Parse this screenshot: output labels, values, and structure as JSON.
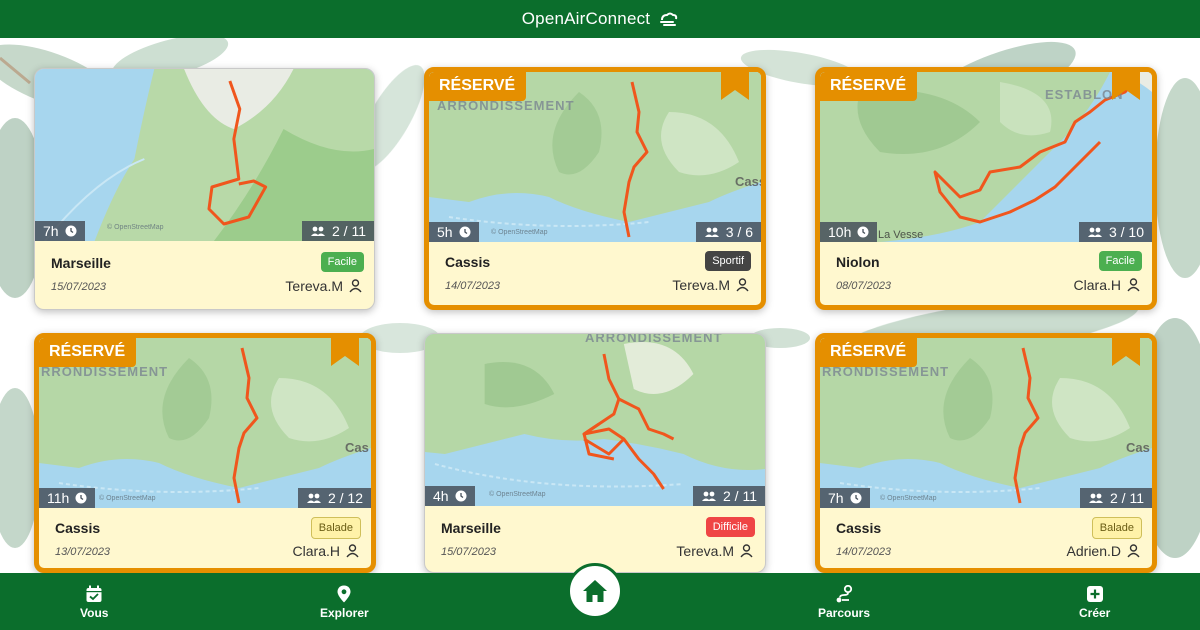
{
  "app": {
    "title": "OpenAirConnect",
    "logo_icon": "cloud-wind-icon",
    "brand_color": "#0b6e2c",
    "accent_color": "#e58f00"
  },
  "cards": [
    {
      "reserved": false,
      "ribbon": "",
      "duration": "7h",
      "group": "2 / 11",
      "place": "Marseille",
      "date": "15/07/2023",
      "author": "Tereva.M",
      "difficulty": "Facile",
      "difficulty_class": "facile",
      "map_labels": []
    },
    {
      "reserved": true,
      "ribbon": "RÉSERVÉ",
      "duration": "5h",
      "group": "3 / 6",
      "place": "Cassis",
      "date": "14/07/2023",
      "author": "Tereva.M",
      "difficulty": "Sportif",
      "difficulty_class": "sportif",
      "map_labels": [
        "ARRONDISSEMENT",
        "Cass"
      ]
    },
    {
      "reserved": true,
      "ribbon": "RÉSERVÉ",
      "duration": "10h",
      "group": "3 / 10",
      "place": "Niolon",
      "date": "08/07/2023",
      "author": "Clara.H",
      "difficulty": "Facile",
      "difficulty_class": "facile",
      "map_labels": [
        "ESTABLON",
        "La Vesse"
      ]
    },
    {
      "reserved": true,
      "ribbon": "RÉSERVÉ",
      "duration": "11h",
      "group": "2 / 12",
      "place": "Cassis",
      "date": "13/07/2023",
      "author": "Clara.H",
      "difficulty": "Balade",
      "difficulty_class": "balade",
      "map_labels": [
        "RRONDISSEMENT",
        "Cas"
      ]
    },
    {
      "reserved": false,
      "ribbon": "",
      "duration": "4h",
      "group": "2 / 11",
      "place": "Marseille",
      "date": "15/07/2023",
      "author": "Tereva.M",
      "difficulty": "Difficile",
      "difficulty_class": "difficile",
      "map_labels": [
        "ARRONDISSEMENT"
      ]
    },
    {
      "reserved": true,
      "ribbon": "RÉSERVÉ",
      "duration": "7h",
      "group": "2 / 11",
      "place": "Cassis",
      "date": "14/07/2023",
      "author": "Adrien.D",
      "difficulty": "Balade",
      "difficulty_class": "balade",
      "map_labels": [
        "RRONDISSEMENT",
        "Cas"
      ]
    }
  ],
  "map_attribution": "© OpenStreetMap",
  "icons": {
    "duration": "clock-icon",
    "group": "group-icon",
    "author": "user-icon",
    "bookmark": "bookmark-icon"
  },
  "nav": {
    "vous": {
      "label": "Vous",
      "icon": "calendar-check-icon"
    },
    "explorer": {
      "label": "Explorer",
      "icon": "map-pin-icon"
    },
    "home": {
      "icon": "home-icon"
    },
    "parcours": {
      "label": "Parcours",
      "icon": "route-icon"
    },
    "creer": {
      "label": "Créer",
      "icon": "plus-square-icon"
    }
  }
}
